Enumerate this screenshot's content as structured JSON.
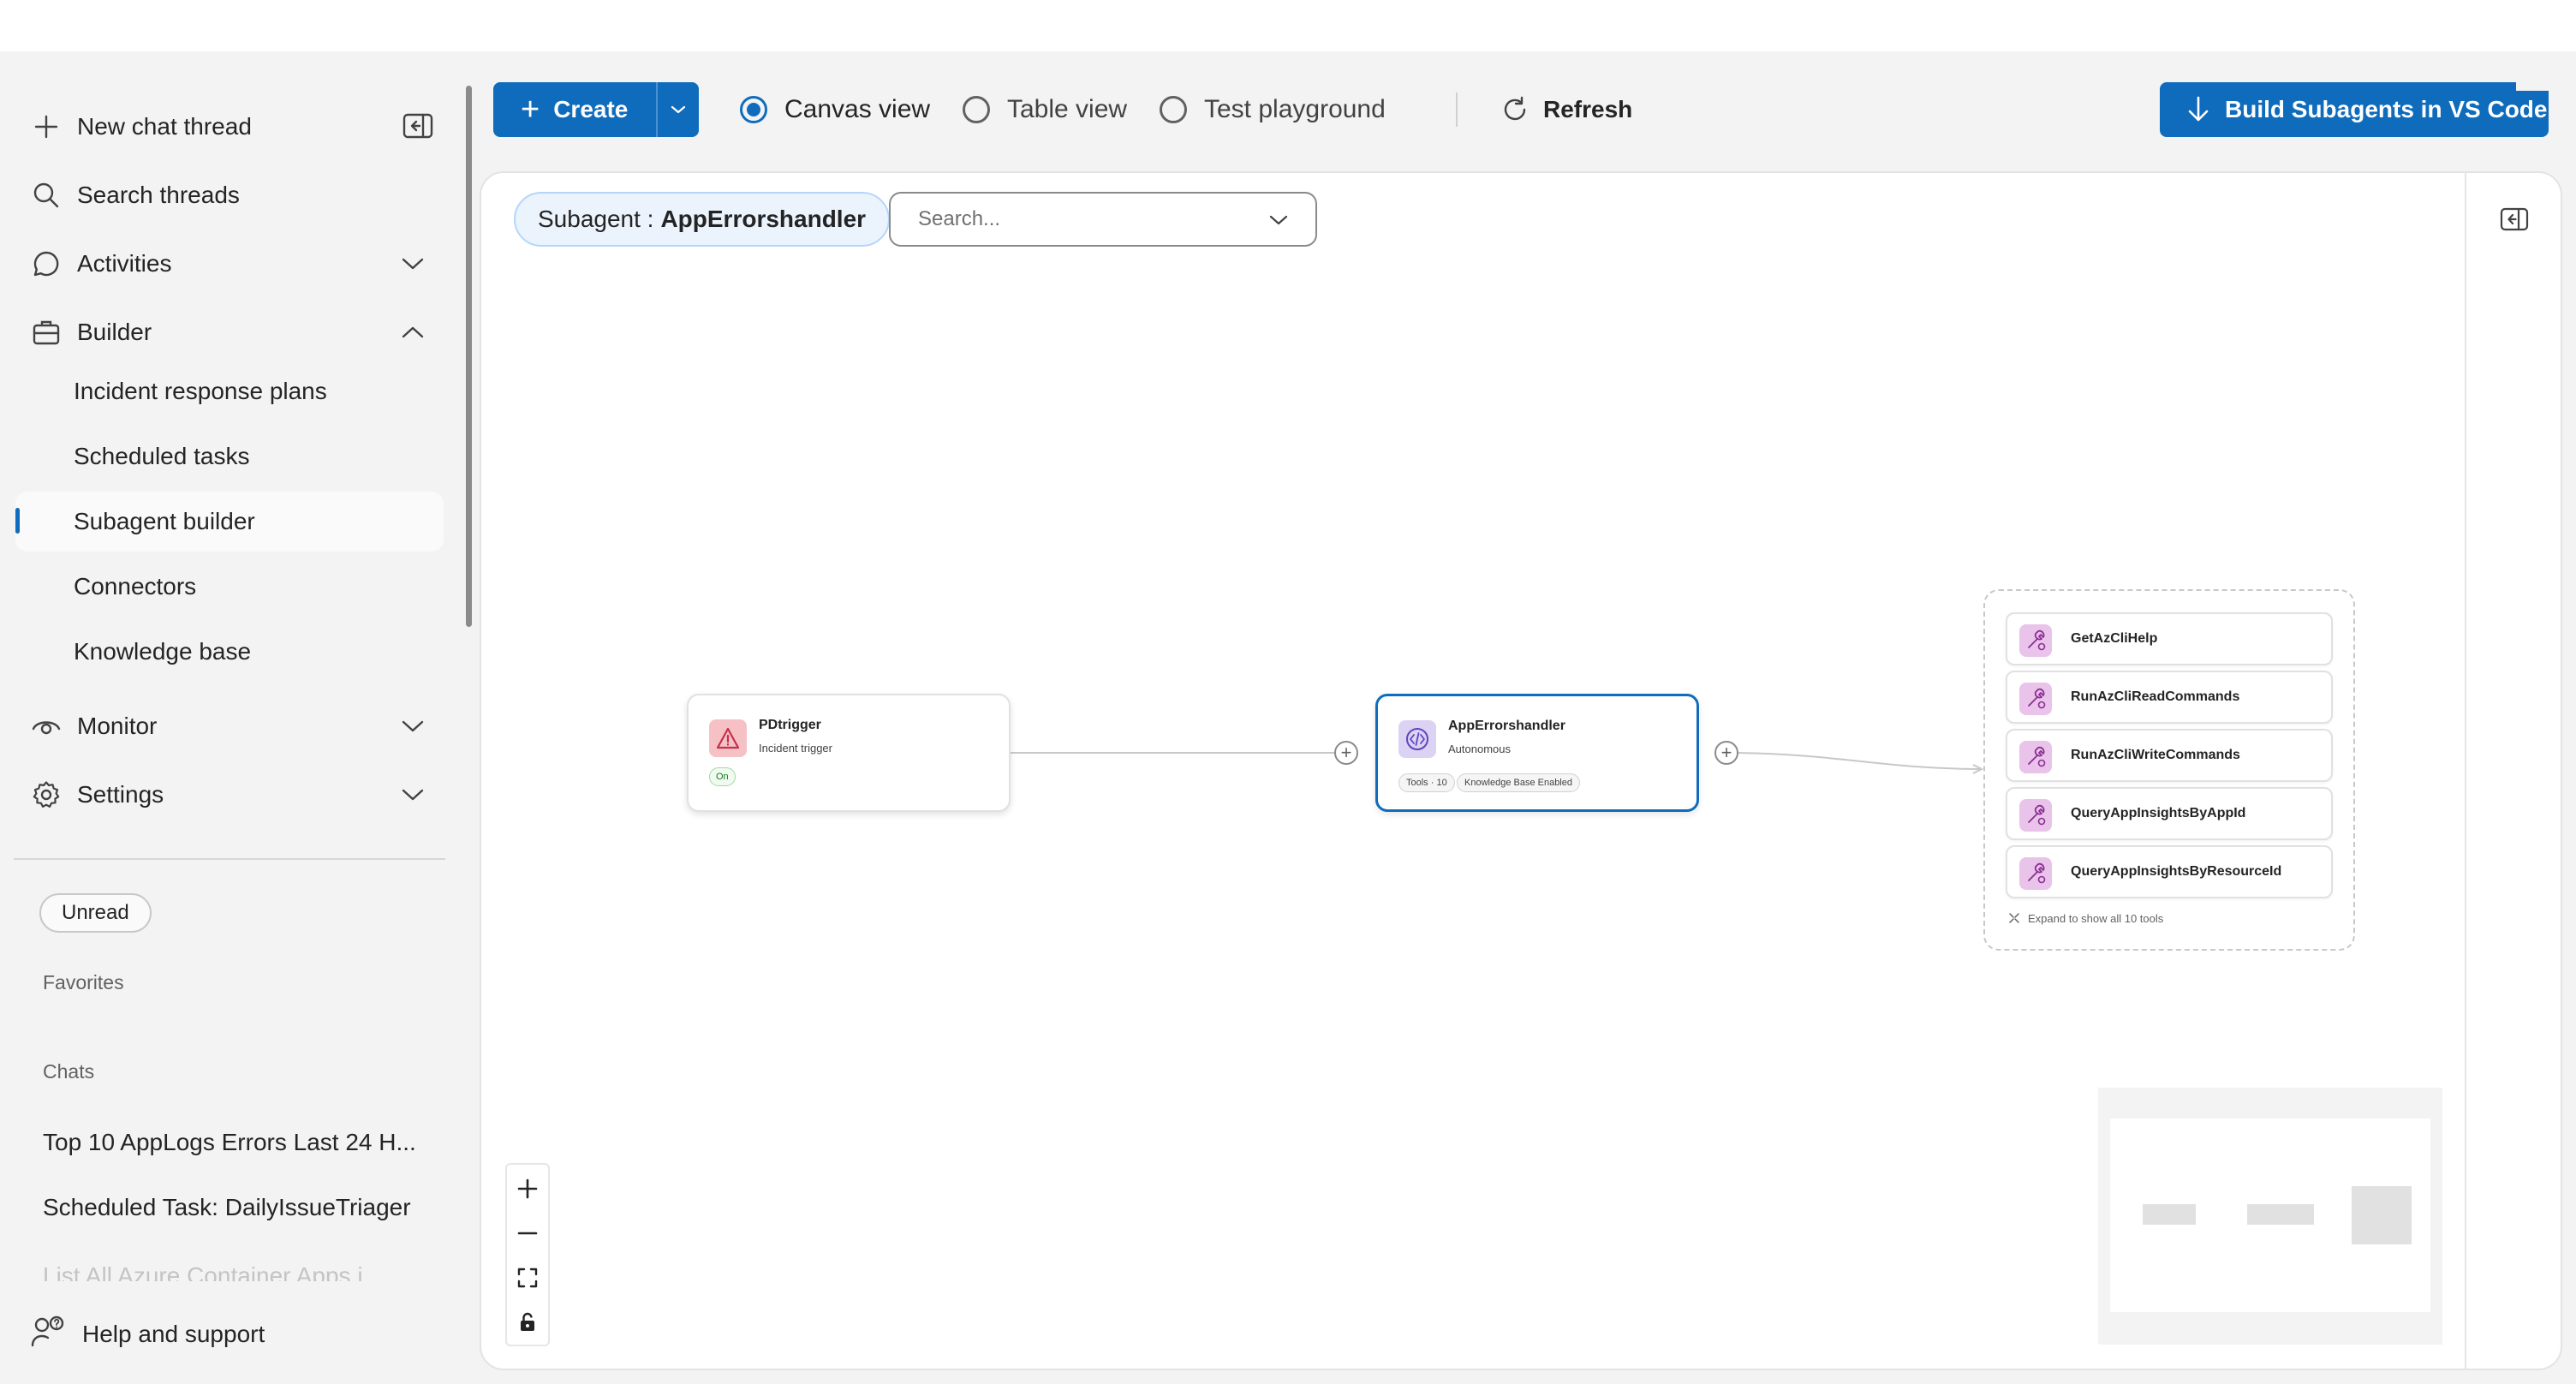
{
  "sidebar": {
    "new_chat": "New chat thread",
    "search_threads": "Search threads",
    "activities": "Activities",
    "builder": "Builder",
    "builder_items": [
      {
        "label": "Incident response plans"
      },
      {
        "label": "Scheduled tasks"
      },
      {
        "label": "Subagent builder",
        "active": true
      },
      {
        "label": "Connectors"
      },
      {
        "label": "Knowledge base"
      }
    ],
    "monitor": "Monitor",
    "settings": "Settings",
    "unread_filter": "Unread",
    "favorites_label": "Favorites",
    "chats_label": "Chats",
    "chats": [
      "Top 10 AppLogs Errors Last 24 H...",
      "Scheduled Task: DailyIssueTriager",
      "List All Azure Container Apps i..."
    ],
    "help": "Help and support"
  },
  "toolbar": {
    "create_label": "Create",
    "views": [
      {
        "label": "Canvas view",
        "selected": true
      },
      {
        "label": "Table view",
        "selected": false
      },
      {
        "label": "Test playground",
        "selected": false
      }
    ],
    "refresh_label": "Refresh",
    "build_vscode_label": "Build Subagents in VS Code"
  },
  "canvas": {
    "subagent_prefix": "Subagent :",
    "subagent_name": "AppErrorshandler",
    "search_placeholder": "Search...",
    "trigger_node": {
      "title": "PDtrigger",
      "subtitle": "Incident trigger",
      "status": "On",
      "icon": "warning-icon"
    },
    "agent_node": {
      "title": "AppErrorshandler",
      "subtitle": "Autonomous",
      "tags": [
        "Tools · 10",
        "Knowledge Base Enabled"
      ],
      "icon": "code-icon"
    },
    "tools": [
      "GetAzCliHelp",
      "RunAzCliReadCommands",
      "RunAzCliWriteCommands",
      "QueryAppInsightsByAppId",
      "QueryAppInsightsByResourceId"
    ],
    "expand_note": "Expand to show all 10 tools"
  },
  "colors": {
    "accent": "#0f6cbd",
    "trigger_icon_bg": "#f6c1c5",
    "agent_icon_bg": "#dcd2f3",
    "tool_icon_bg": "#e9c3ea",
    "status_on": "#107c10"
  }
}
